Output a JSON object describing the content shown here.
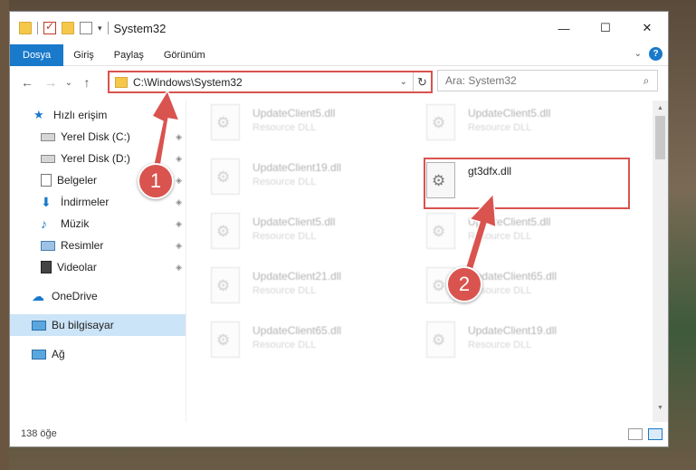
{
  "window": {
    "title": "System32",
    "controls": {
      "minimize": "—",
      "maximize": "☐",
      "close": "✕"
    }
  },
  "ribbon": {
    "tabs": [
      "Dosya",
      "Giriş",
      "Paylaş",
      "Görünüm"
    ],
    "help_label": "?"
  },
  "nav": {
    "back": "←",
    "forward": "→",
    "recent": "⌄",
    "up": "↑",
    "address": "C:\\Windows\\System32",
    "refresh": "↻",
    "search_placeholder": "Ara: System32",
    "search_icon": "⌕"
  },
  "sidebar": {
    "items": [
      {
        "label": "Hızlı erişim",
        "icon": "star-icon",
        "pinned": false
      },
      {
        "label": "Yerel Disk (C:)",
        "icon": "drive-icon",
        "pinned": true
      },
      {
        "label": "Yerel Disk (D:)",
        "icon": "drive-icon",
        "pinned": true
      },
      {
        "label": "Belgeler",
        "icon": "documents-icon",
        "pinned": true
      },
      {
        "label": "İndirmeler",
        "icon": "download-icon",
        "pinned": true
      },
      {
        "label": "Müzik",
        "icon": "music-icon",
        "pinned": true
      },
      {
        "label": "Resimler",
        "icon": "pictures-icon",
        "pinned": true
      },
      {
        "label": "Videolar",
        "icon": "videos-icon",
        "pinned": true
      },
      {
        "label": "OneDrive",
        "icon": "cloud-icon",
        "pinned": false
      },
      {
        "label": "Bu bilgisayar",
        "icon": "computer-icon",
        "pinned": false
      },
      {
        "label": "Ağ",
        "icon": "network-icon",
        "pinned": false
      }
    ],
    "pin_glyph": "📌"
  },
  "files": {
    "left": [
      {
        "name": "UpdateClient5.dll",
        "type": "Resource DLL"
      },
      {
        "name": "UpdateClient19.dll",
        "type": "Resource DLL"
      },
      {
        "name": "UpdateClient5.dll",
        "type": "Resource DLL"
      },
      {
        "name": "UpdateClient21.dll",
        "type": "Resource DLL"
      },
      {
        "name": "UpdateClient65.dll",
        "type": "Resource DLL"
      }
    ],
    "right": [
      {
        "name": "UpdateClient5.dll",
        "type": "Resource DLL"
      },
      {
        "name": "gt3dfx.dll",
        "type": ""
      },
      {
        "name": "UpdateClient5.dll",
        "type": "Resource DLL"
      },
      {
        "name": "UpdateClient65.dll",
        "type": "Resource DLL"
      },
      {
        "name": "UpdateClient19.dll",
        "type": "Resource DLL"
      }
    ]
  },
  "status": {
    "item_count": "138 öğe"
  },
  "annotations": {
    "badge_1": "1",
    "badge_2": "2",
    "color": "#d9534f"
  }
}
